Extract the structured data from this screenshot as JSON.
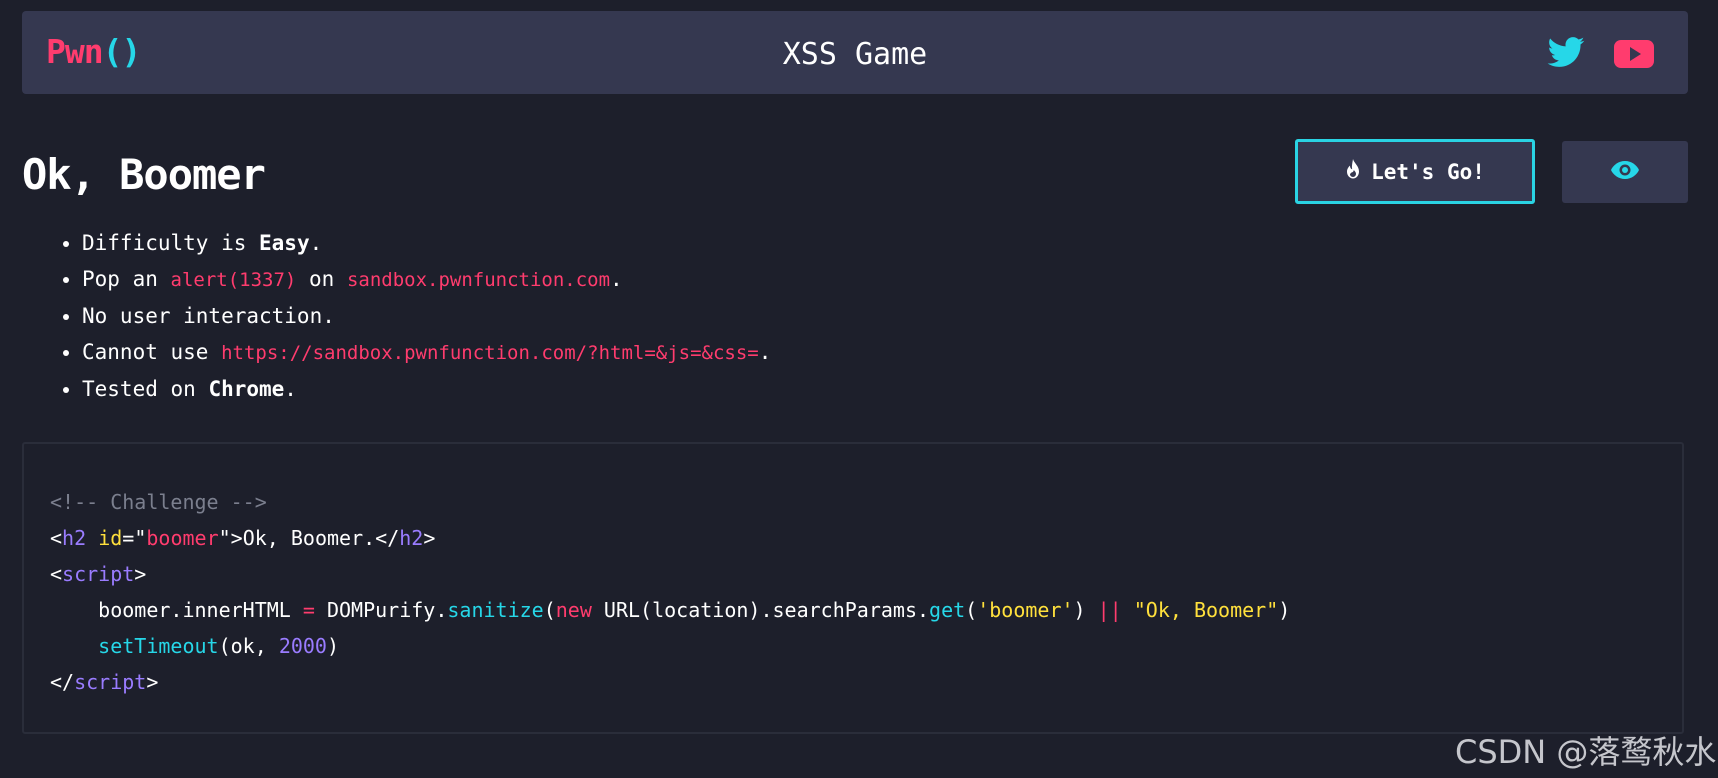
{
  "header": {
    "logo_main": "Pwn",
    "logo_parens": "()",
    "title": "XSS Game"
  },
  "challenge": {
    "title": "Ok, Boomer",
    "go_button": "Let's Go!"
  },
  "bullets": {
    "b1_pre": "Difficulty is ",
    "b1_bold": "Easy",
    "b1_post": ".",
    "b2_pre": "Pop an ",
    "b2_code1": "alert(1337)",
    "b2_mid": " on ",
    "b2_code2": "sandbox.pwnfunction.com",
    "b2_post": ".",
    "b3": "No user interaction.",
    "b4_pre": "Cannot use ",
    "b4_code": "https://sandbox.pwnfunction.com/?html=&js=&css=",
    "b4_post": ".",
    "b5_pre": "Tested on ",
    "b5_bold": "Chrome",
    "b5_post": "."
  },
  "code": {
    "comment": "<!-- Challenge -->",
    "l2_open": "<",
    "l2_tag": "h2",
    "l2_sp": " ",
    "l2_attr": "id",
    "l2_eq": "=\"",
    "l2_val": "boomer",
    "l2_q": "\">",
    "l2_text": "Ok, Boomer.",
    "l2_close_open": "</",
    "l2_close_tag": "h2",
    "l2_close_end": ">",
    "l3_open": "<",
    "l3_tag": "script",
    "l3_end": ">",
    "l4_indent": "    ",
    "l4_a": "boomer.innerHTML ",
    "l4_eq": "=",
    "l4_b": " DOMPurify.",
    "l4_fn": "sanitize",
    "l4_c": "(",
    "l4_new": "new",
    "l4_d": " URL(location).searchParams.",
    "l4_get": "get",
    "l4_e": "(",
    "l4_s1": "'boomer'",
    "l4_f": ") ",
    "l4_or": "||",
    "l4_g": " ",
    "l4_s2": "\"Ok, Boomer\"",
    "l4_h": ")",
    "l5_indent": "    ",
    "l5_fn": "setTimeout",
    "l5_a": "(ok, ",
    "l5_num": "2000",
    "l5_b": ")",
    "l6_open": "</",
    "l6_tag": "script",
    "l6_end": ">"
  },
  "watermark": "CSDN @落鹜秋水",
  "colors": {
    "background": "#1d1f2b",
    "panel": "#353850",
    "accent_pink": "#ff3c6e",
    "accent_cyan": "#26d7e8"
  },
  "icons": {
    "social_1": "twitter-icon",
    "social_2": "youtube-icon",
    "go_button": "flame-icon",
    "view_button": "eye-icon"
  }
}
